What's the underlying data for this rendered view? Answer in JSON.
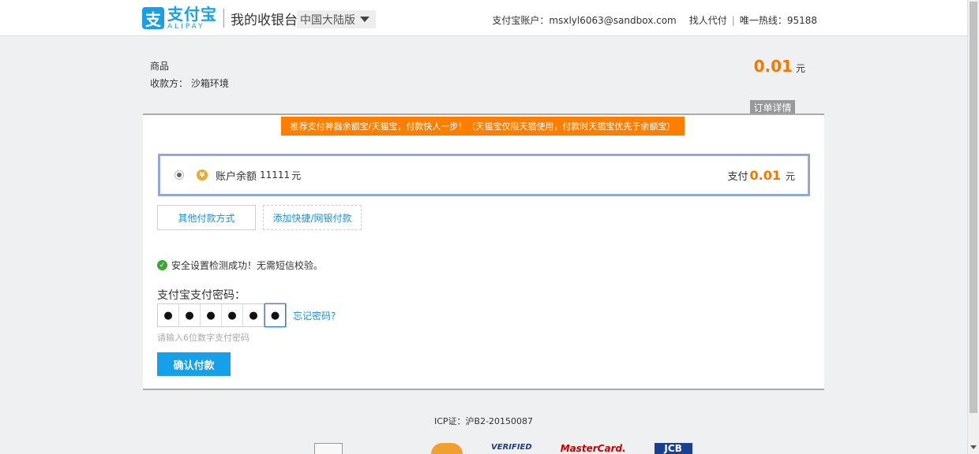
{
  "header": {
    "logo_zh": "支付宝",
    "logo_en": "ALIPAY",
    "cashier_title": "我的收银台",
    "region": "中国大陆版",
    "account_label": "支付宝账户：",
    "account": "msxlyl6063@sandbox.com",
    "find_payer": "找人代付",
    "hotline": "唯一热线：95188"
  },
  "order": {
    "name": "商品",
    "payee": "收款方： 沙箱环境",
    "amount": "0.01",
    "unit": "元",
    "detail_label": "订单详情"
  },
  "promo": "推荐支付神器余额宝/天猫宝，付款快人一步！（天猫宝仅限天猫使用，付款时天猫宝优先于余额宝）",
  "method": {
    "label": "账户余额",
    "balance": "11111",
    "balance_unit": "元",
    "pay_label": "支付",
    "pay_amount": "0.01",
    "pay_unit": "元"
  },
  "buttons": {
    "other_methods": "其他付款方式",
    "add_quick": "添加快捷/网银付款",
    "confirm": "确认付款"
  },
  "security": {
    "message": "安全设置检测成功！无需短信校验。"
  },
  "password": {
    "label": "支付宝支付密码：",
    "dots": [
      "●",
      "●",
      "●",
      "●",
      "●",
      "●"
    ],
    "forgot": "忘记密码?",
    "hint": "请输入6位数字支付密码"
  },
  "footer": {
    "icp": "ICP证：沪B2-20150087",
    "badges": [
      "",
      "",
      "",
      "VERIFIED",
      "MasterCard.",
      "JCB"
    ]
  },
  "icons": {
    "region_caret": "chevron-down-icon",
    "yuan": "¥",
    "check": "✓"
  },
  "colors": {
    "brand_blue": "#1a9fe5",
    "amount_orange": "#f37800",
    "promo_orange": "#ff7e00",
    "confirm_blue": "#15a0e9",
    "success_green": "#3ca534"
  }
}
